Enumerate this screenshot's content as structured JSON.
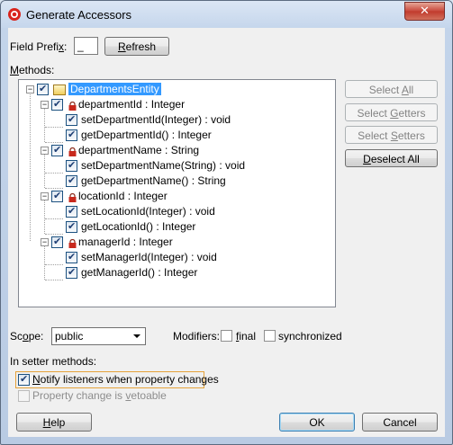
{
  "window": {
    "title": "Generate Accessors",
    "close_glyph": "✕",
    "title_icon": "app-logo-icon"
  },
  "field_prefix": {
    "label_pre": "Field Prefi",
    "label_key": "x",
    "label_post": ":",
    "value": "_",
    "refresh_key": "R",
    "refresh_rest": "efresh"
  },
  "methods": {
    "label_key": "M",
    "label_rest": "ethods:",
    "tree": {
      "root": "DepartmentsEntity",
      "fields": [
        {
          "name": "departmentId : Integer",
          "methods": [
            "setDepartmentId(Integer) : void",
            "getDepartmentId() : Integer"
          ]
        },
        {
          "name": "departmentName : String",
          "methods": [
            "setDepartmentName(String) : void",
            "getDepartmentName() : String"
          ]
        },
        {
          "name": "locationId : Integer",
          "methods": [
            "setLocationId(Integer) : void",
            "getLocationId() : Integer"
          ]
        },
        {
          "name": "managerId : Integer",
          "methods": [
            "setManagerId(Integer) : void",
            "getManagerId() : Integer"
          ]
        }
      ]
    }
  },
  "side_buttons": {
    "select_all": {
      "pre": "Select ",
      "key": "A",
      "post": "ll"
    },
    "select_getters": {
      "pre": "Select ",
      "key": "G",
      "post": "etters"
    },
    "select_setters": {
      "pre": "Select ",
      "key": "S",
      "post": "etters"
    },
    "deselect_all": {
      "pre": "",
      "key": "D",
      "post": "eselect All"
    }
  },
  "scope": {
    "label_pre": "Sc",
    "label_key": "o",
    "label_post": "pe:",
    "value": "public"
  },
  "modifiers": {
    "label": "Modifiers:",
    "final_key": "f",
    "final_rest": "inal",
    "synchronized_label": "synchronized"
  },
  "setter": {
    "heading": "In setter methods:",
    "notify_key": "N",
    "notify_rest": "otify listeners when property changes",
    "vetoable_pre": "Property change is ",
    "vetoable_key": "v",
    "vetoable_post": "etoable"
  },
  "footer": {
    "help_key": "H",
    "help_rest": "elp",
    "ok": "OK",
    "cancel": "Cancel"
  }
}
